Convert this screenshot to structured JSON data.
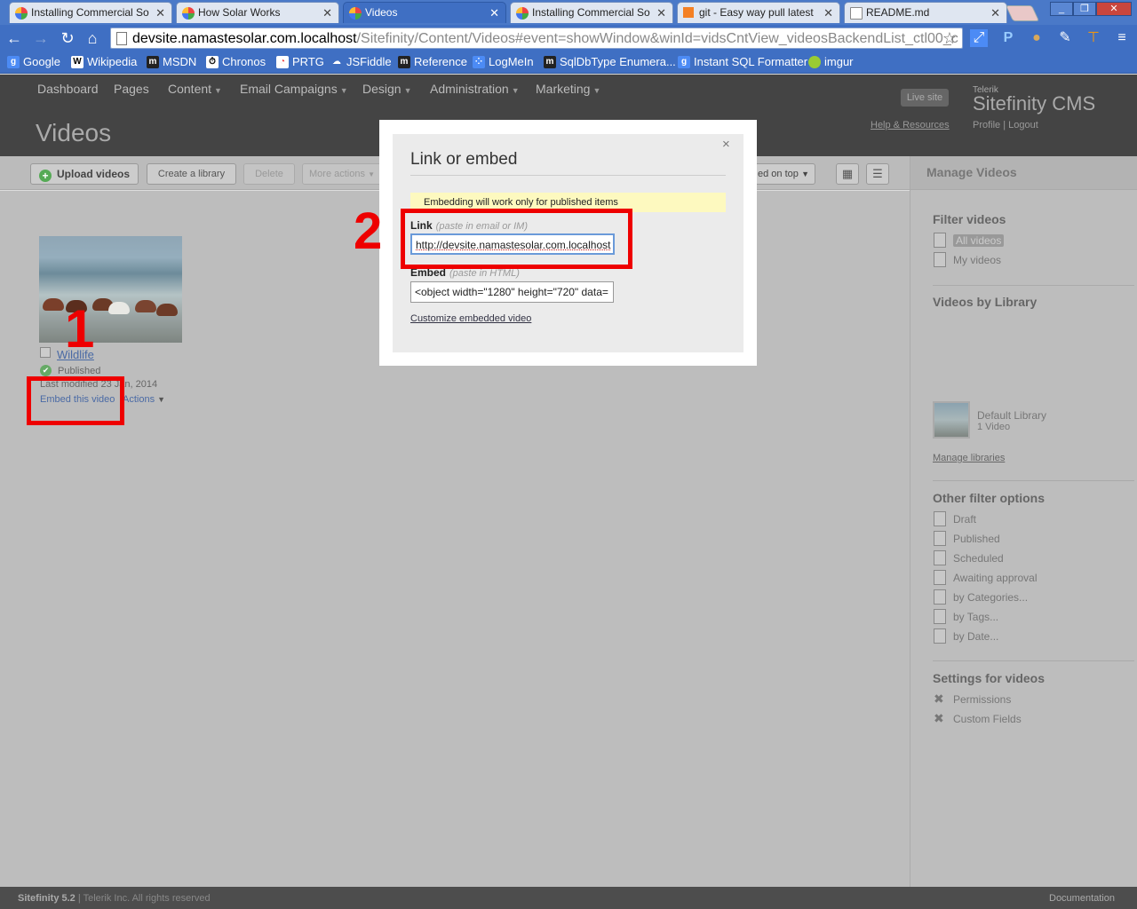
{
  "browser": {
    "tabs": [
      {
        "title": "Installing Commercial So",
        "icon": "sitefinity-icon",
        "active": false
      },
      {
        "title": "How Solar Works",
        "icon": "sitefinity-icon",
        "active": false
      },
      {
        "title": "Videos",
        "icon": "sitefinity-icon",
        "active": true
      },
      {
        "title": "Installing Commercial So",
        "icon": "sitefinity-icon",
        "active": false
      },
      {
        "title": "git - Easy way pull latest",
        "icon": "stackoverflow-icon",
        "active": false
      },
      {
        "title": "README.md",
        "icon": "document-icon",
        "active": false
      }
    ],
    "url_host": "devsite.namastesolar.com.localhost",
    "url_path": "/Sitefinity/Content/Videos#event=showWindow&winId=vidsCntView_videosBackendList_ctl00_c",
    "bookmarks": [
      "Google",
      "Wikipedia",
      "MSDN",
      "Chronos",
      "PRTG",
      "JSFiddle",
      "Reference",
      "LogMeIn",
      "SqlDbType Enumera...",
      "Instant SQL Formatter",
      "imgur"
    ]
  },
  "cms": {
    "menu": [
      {
        "label": "Dashboard",
        "dropdown": false
      },
      {
        "label": "Pages",
        "dropdown": false
      },
      {
        "label": "Content",
        "dropdown": true
      },
      {
        "label": "Email Campaigns",
        "dropdown": true
      },
      {
        "label": "Design",
        "dropdown": true
      },
      {
        "label": "Administration",
        "dropdown": true
      },
      {
        "label": "Marketing",
        "dropdown": true
      }
    ],
    "page_title": "Videos",
    "live_site": "Live site",
    "brand_small": "Telerik",
    "brand_main": "Sitefinity CMS",
    "help_link": "Help & Resources",
    "profile": "Profile",
    "logout": "Logout",
    "toolbar": {
      "upload": "Upload videos",
      "create_library": "Create a library",
      "delete": "Delete",
      "more_actions": "More actions",
      "sort": "ed on top"
    },
    "video": {
      "title": "Wildlife",
      "status": "Published",
      "last_modified": "Last modified 23 Jan, 2014",
      "embed_link": "Embed this video",
      "actions": "Actions"
    },
    "sidebar": {
      "header": "Manage Videos",
      "filter_title": "Filter videos",
      "all_videos": "All videos",
      "my_videos": "My videos",
      "by_library_title": "Videos by Library",
      "library_name": "Default Library",
      "library_count": "1 Video",
      "manage_libraries": "Manage libraries",
      "other_title": "Other filter options",
      "other_options": [
        "Draft",
        "Published",
        "Scheduled",
        "Awaiting approval",
        "by Categories...",
        "by Tags...",
        "by Date..."
      ],
      "settings_title": "Settings for videos",
      "settings_items": [
        "Permissions",
        "Custom Fields"
      ]
    },
    "footer": {
      "product": "Sitefinity 5.2",
      "company": "Telerik Inc. All rights reserved",
      "documentation": "Documentation"
    }
  },
  "modal": {
    "title": "Link or embed",
    "close": "×",
    "notice": "Embedding will work only for published items",
    "link_label": "Link",
    "link_hint": "(paste in email or IM)",
    "link_value": "http://devsite.namastesolar.com.localhost",
    "embed_label": "Embed",
    "embed_hint": "(paste in HTML)",
    "embed_value": "<object width=\"1280\" height=\"720\" data=",
    "customize": "Customize embedded video"
  },
  "annotations": {
    "step1": "1",
    "step2": "2",
    "color": "#ee0000"
  }
}
